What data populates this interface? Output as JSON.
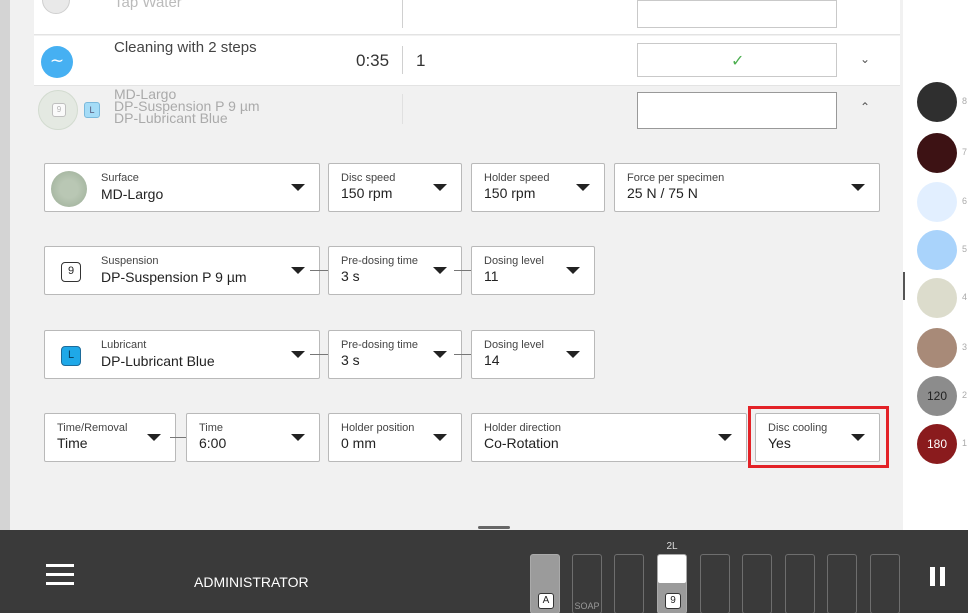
{
  "steps": [
    {
      "name": "Tap Water",
      "time": "",
      "repeats": "",
      "status": ""
    },
    {
      "name": "Cleaning with 2 steps",
      "time": "0:35",
      "repeats": "1",
      "status": "✓"
    },
    {
      "name": "MD-Largo\nDP-Suspension P 9 µm\nDP-Lubricant Blue",
      "time": "",
      "repeats": "",
      "status": ""
    }
  ],
  "step_icons": {
    "step2_suspension": "9",
    "step2_lubricant": "L"
  },
  "fields": {
    "surface": {
      "label": "Surface",
      "value": "MD-Largo"
    },
    "disc_speed": {
      "label": "Disc speed",
      "value": "150 rpm"
    },
    "holder_speed": {
      "label": "Holder speed",
      "value": "150 rpm"
    },
    "force": {
      "label": "Force per specimen",
      "value": "25 N / 75 N"
    },
    "suspension": {
      "label": "Suspension",
      "value": "DP-Suspension P 9 µm",
      "icon_text": "9"
    },
    "susp_predose": {
      "label": "Pre-dosing time",
      "value": "3 s"
    },
    "susp_dosing": {
      "label": "Dosing level",
      "value": "11"
    },
    "lubricant": {
      "label": "Lubricant",
      "value": "DP-Lubricant Blue",
      "icon_text": "L"
    },
    "lub_predose": {
      "label": "Pre-dosing time",
      "value": "3 s"
    },
    "lub_dosing": {
      "label": "Dosing level",
      "value": "14"
    },
    "time_removal": {
      "label": "Time/Removal",
      "value": "Time"
    },
    "time": {
      "label": "Time",
      "value": "6:00"
    },
    "holder_position": {
      "label": "Holder position",
      "value": "0 mm"
    },
    "holder_direction": {
      "label": "Holder direction",
      "value": "Co-Rotation"
    },
    "disc_cooling": {
      "label": "Disc cooling",
      "value": "Yes"
    }
  },
  "palette": [
    {
      "num": "8",
      "color": "#2f2f2f",
      "text": ""
    },
    {
      "num": "7",
      "color": "#3d1214",
      "text": ""
    },
    {
      "num": "6",
      "color": "#e2efff",
      "text": ""
    },
    {
      "num": "5",
      "color": "#a9d3fb",
      "text": ""
    },
    {
      "num": "4",
      "color": "#dcdccc",
      "text": ""
    },
    {
      "num": "3",
      "color": "#a88a78",
      "text": ""
    },
    {
      "num": "2",
      "color": "#8c8c8c",
      "text": "120"
    },
    {
      "num": "1",
      "color": "#8a1b1d",
      "text": "180"
    }
  ],
  "footer": {
    "user": "ADMINISTRATOR",
    "slot_a": "A",
    "slot_soap": "SOAP",
    "slot_9_top": "2L",
    "slot_9": "9"
  },
  "colors": {
    "accent_blue": "#3aa6f0",
    "highlight": "#e32227",
    "check": "#4caf50"
  }
}
